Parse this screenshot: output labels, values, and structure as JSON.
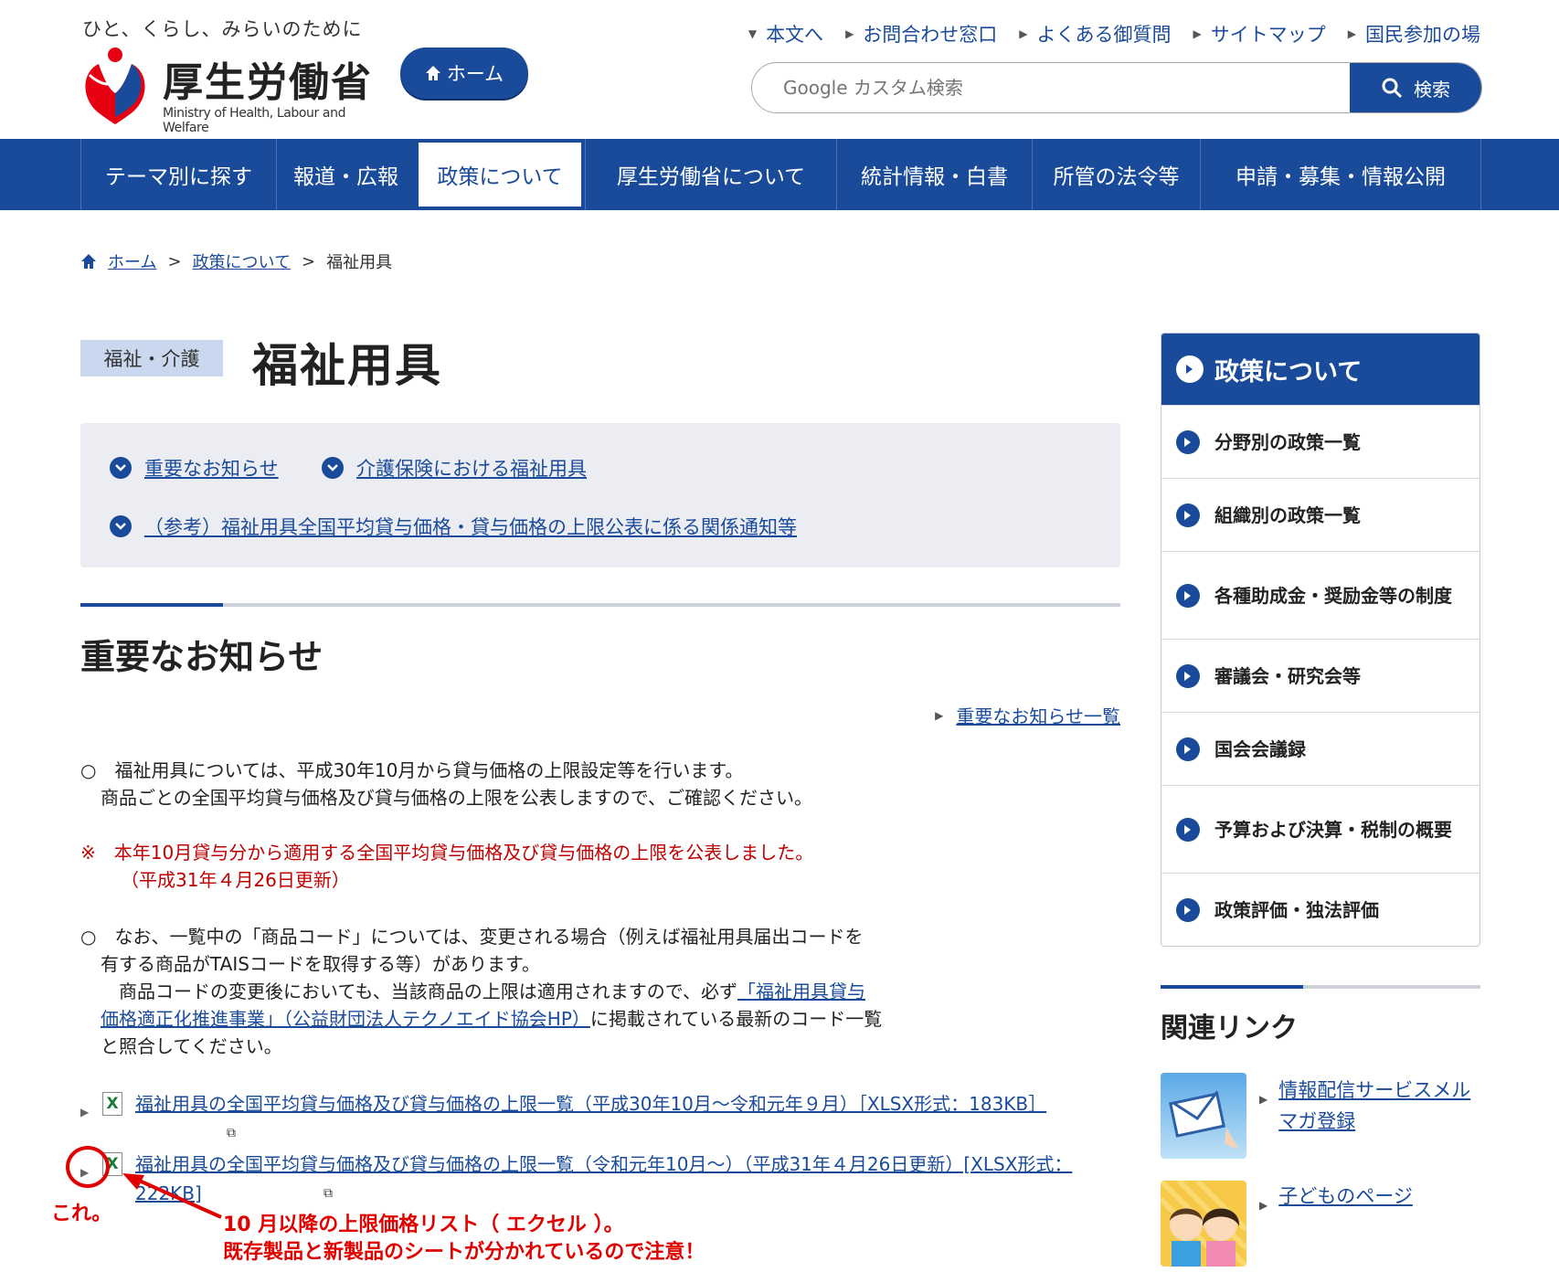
{
  "header": {
    "tagline": "ひと、くらし、みらいのために",
    "logo_text": "厚生労働省",
    "logo_en": "Ministry of Health, Labour and Welfare",
    "home_label": "ホーム",
    "utility_links": [
      "本文へ",
      "お問合わせ窓口",
      "よくある御質問",
      "サイトマップ",
      "国民参加の場"
    ],
    "search_placeholder": "Google カスタム検索",
    "search_label": "検索"
  },
  "nav": {
    "items": [
      "テーマ別に探す",
      "報道・広報",
      "政策について",
      "厚生労働省について",
      "統計情報・白書",
      "所管の法令等",
      "申請・募集・情報公開"
    ],
    "active_index": 2
  },
  "breadcrumb": [
    "ホーム",
    "政策について",
    "福祉用具"
  ],
  "page": {
    "category": "福祉・介護",
    "title": "福祉用具"
  },
  "anchors": [
    "重要なお知らせ",
    "介護保険における福祉用具",
    "（参考）福祉用具全国平均貸与価格・貸与価格の上限公表に係る関係通知等"
  ],
  "section": {
    "title": "重要なお知らせ",
    "more_link": "重要なお知らせ一覧",
    "para1_line1": "○　福祉用具については、平成30年10月から貸与価格の上限設定等を行います。",
    "para1_line2": "商品ごとの全国平均貸与価格及び貸与価格の上限を公表しますので、ご確認ください。",
    "notice_line1": "※　本年10月貸与分から適用する全国平均貸与価格及び貸与価格の上限を公表しました。",
    "notice_line2": "（平成31年４月26日更新）",
    "para2_line1": "○　なお、一覧中の「商品コード」については、変更される場合（例えば福祉用具届出コードを",
    "para2_line2": "有する商品がTAISコードを取得する等）があります。",
    "para2_line3_pre": "　商品コードの変更後においても、当該商品の上限は適用されますので、必ず",
    "para2_link_a": "「福祉用具貸与",
    "para2_link_b": "価格適正化推進事業」（公益財団法人テクノエイド協会HP）",
    "para2_line4_post": "に掲載されている最新のコード一覧",
    "para2_line5": "と照合してください。",
    "files": [
      "福祉用具の全国平均貸与価格及び貸与価格の上限一覧（平成30年10月～令和元年９月）［XLSX形式：183KB］",
      "福祉用具の全国平均貸与価格及び貸与価格の上限一覧（令和元年10月～）（平成31年４月26日更新）[XLSX形式：222KB]"
    ]
  },
  "annotation": {
    "kore": "これ。",
    "note1": "10 月以降の上限価格リスト（ エクセル ）。",
    "note2": "既存製品と新製品のシートが分かれているので注意！"
  },
  "sidebar": {
    "title": "政策について",
    "items": [
      "分野別の政策一覧",
      "組織別の政策一覧",
      "各種助成金・奨励金等の制度",
      "審議会・研究会等",
      "国会会議録",
      "予算および決算・税制の概要",
      "政策評価・独法評価"
    ]
  },
  "related": {
    "title": "関連リンク",
    "links": [
      "情報配信サービスメルマガ登録",
      "子どものページ"
    ]
  },
  "colors": {
    "brand": "#1a4b9b",
    "notice_red": "#c00000",
    "annotation_red": "#e00000"
  }
}
